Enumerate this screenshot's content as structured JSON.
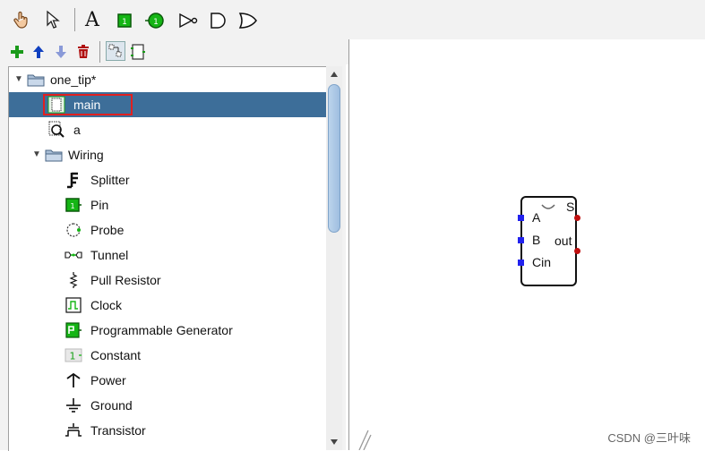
{
  "toolbar": {
    "tools": [
      {
        "name": "hand-poke-tool",
        "icon": "hand-icon"
      },
      {
        "name": "select-tool",
        "icon": "pointer-icon"
      },
      {
        "name": "text-tool",
        "icon": "text-icon",
        "glyph": "A"
      },
      {
        "name": "input-pin-tool",
        "icon": "input-pin-icon"
      },
      {
        "name": "output-pin-tool",
        "icon": "output-pin-icon"
      },
      {
        "name": "not-gate-tool",
        "icon": "not-gate-icon"
      },
      {
        "name": "and-gate-tool",
        "icon": "and-gate-icon"
      },
      {
        "name": "or-gate-tool",
        "icon": "or-gate-icon"
      }
    ],
    "project_tools": [
      {
        "name": "add-circuit",
        "icon": "plus-icon",
        "color": "#1a9a1a"
      },
      {
        "name": "move-up",
        "icon": "arrow-up-icon",
        "color": "#1040c0"
      },
      {
        "name": "move-down",
        "icon": "arrow-down-icon",
        "color": "#8a9ad8"
      },
      {
        "name": "delete-circuit",
        "icon": "trash-icon",
        "color": "#b01010"
      },
      {
        "name": "show-tools",
        "icon": "toolbox-icon"
      },
      {
        "name": "show-simulation",
        "icon": "simulation-icon"
      }
    ]
  },
  "tree": {
    "project": {
      "label": "one_tip*",
      "expanded": true
    },
    "circuits": [
      {
        "label": "main",
        "selected": true,
        "icon": "circuit-icon"
      },
      {
        "label": "a",
        "selected": false,
        "icon": "circuit-magnifier-icon"
      }
    ],
    "library": {
      "label": "Wiring",
      "expanded": true
    },
    "items": [
      {
        "label": "Splitter",
        "icon": "splitter-icon"
      },
      {
        "label": "Pin",
        "icon": "pin-icon"
      },
      {
        "label": "Probe",
        "icon": "probe-icon"
      },
      {
        "label": "Tunnel",
        "icon": "tunnel-icon"
      },
      {
        "label": "Pull Resistor",
        "icon": "pull-resistor-icon"
      },
      {
        "label": "Clock",
        "icon": "clock-icon"
      },
      {
        "label": "Programmable Generator",
        "icon": "programmable-generator-icon"
      },
      {
        "label": "Constant",
        "icon": "constant-icon",
        "glyph": "1"
      },
      {
        "label": "Power",
        "icon": "power-icon"
      },
      {
        "label": "Ground",
        "icon": "ground-icon"
      },
      {
        "label": "Transistor",
        "icon": "transistor-icon"
      }
    ]
  },
  "component": {
    "inputs": [
      "A",
      "B",
      "Cin"
    ],
    "outputs": [
      "S",
      "out"
    ]
  },
  "watermark": "CSDN @三叶味",
  "colors": {
    "selection": "#3d6e99",
    "highlight": "#e02020",
    "pin_in": "#2222ee",
    "pin_out": "#c01010"
  }
}
